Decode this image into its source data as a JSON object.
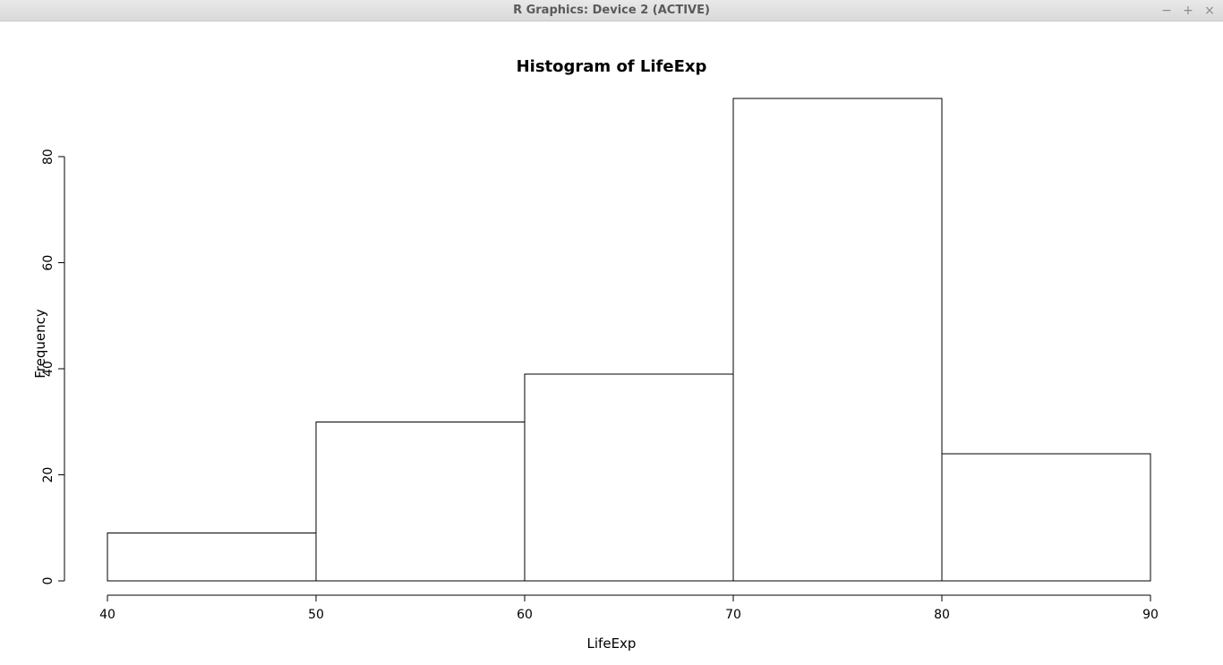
{
  "window": {
    "title": "R Graphics: Device 2 (ACTIVE)"
  },
  "chart_data": {
    "type": "bar",
    "title": "Histogram of LifeExp",
    "xlabel": "LifeExp",
    "ylabel": "Frequency",
    "x_breaks": [
      40,
      50,
      60,
      70,
      80,
      90
    ],
    "y_ticks": [
      0,
      20,
      40,
      60,
      80
    ],
    "xlim": [
      40,
      90
    ],
    "ylim": [
      0,
      90
    ],
    "bins": [
      {
        "from": 40,
        "to": 50,
        "count": 9
      },
      {
        "from": 50,
        "to": 60,
        "count": 30
      },
      {
        "from": 60,
        "to": 70,
        "count": 39
      },
      {
        "from": 70,
        "to": 80,
        "count": 91
      },
      {
        "from": 80,
        "to": 90,
        "count": 24
      }
    ]
  }
}
